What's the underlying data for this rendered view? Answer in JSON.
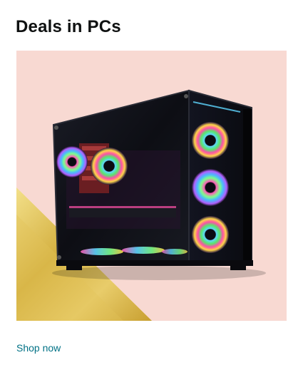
{
  "card": {
    "title": "Deals in PCs",
    "link_label": "Shop now",
    "image_subject": "pc-case-rgb-fans"
  },
  "colors": {
    "title": "#0f1111",
    "link": "#007185",
    "image_background": "#f8d9d2",
    "gold_accent": "#d9b848"
  }
}
